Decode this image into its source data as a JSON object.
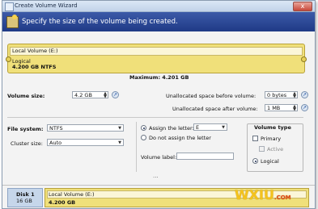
{
  "window": {
    "title": "Create Volume Wizard",
    "close_label": "x",
    "header": "Specify the size of the volume being created."
  },
  "volume_bar": {
    "name": "Local Volume (E:)",
    "type": "Logical",
    "size_fs": "4.200 GB NTFS",
    "maximum": "Maximum: 4.201 GB"
  },
  "sizes": {
    "volume_size_label": "Volume size:",
    "volume_size_value": "4.2 GB",
    "unalloc_before_label": "Unallocated space before volume:",
    "unalloc_before_value": "0 bytes",
    "unalloc_after_label": "Unallocated space after volume:",
    "unalloc_after_value": "1 MB"
  },
  "filesystem": {
    "label": "File system:",
    "value": "NTFS",
    "cluster_label": "Cluster size:",
    "cluster_value": "Auto"
  },
  "letter": {
    "assign_label": "Assign the letter:",
    "assign_value": "E",
    "no_assign_label": "Do not assign the letter",
    "volume_label_label": "Volume label:",
    "volume_label_value": ""
  },
  "volume_type": {
    "title": "Volume type",
    "primary": "Primary",
    "active": "Active",
    "logical": "Logical"
  },
  "more": "...",
  "disk_map": {
    "disk_name": "Disk 1",
    "disk_size": "16 GB",
    "volume_name": "Local Volume (E:)",
    "volume_size": "4.200 GB"
  },
  "watermark": {
    "main": "WXIU",
    "suffix": ".COM"
  },
  "colors": {
    "header_bg": "#2b479a",
    "volume_fill": "#f0e07a"
  }
}
